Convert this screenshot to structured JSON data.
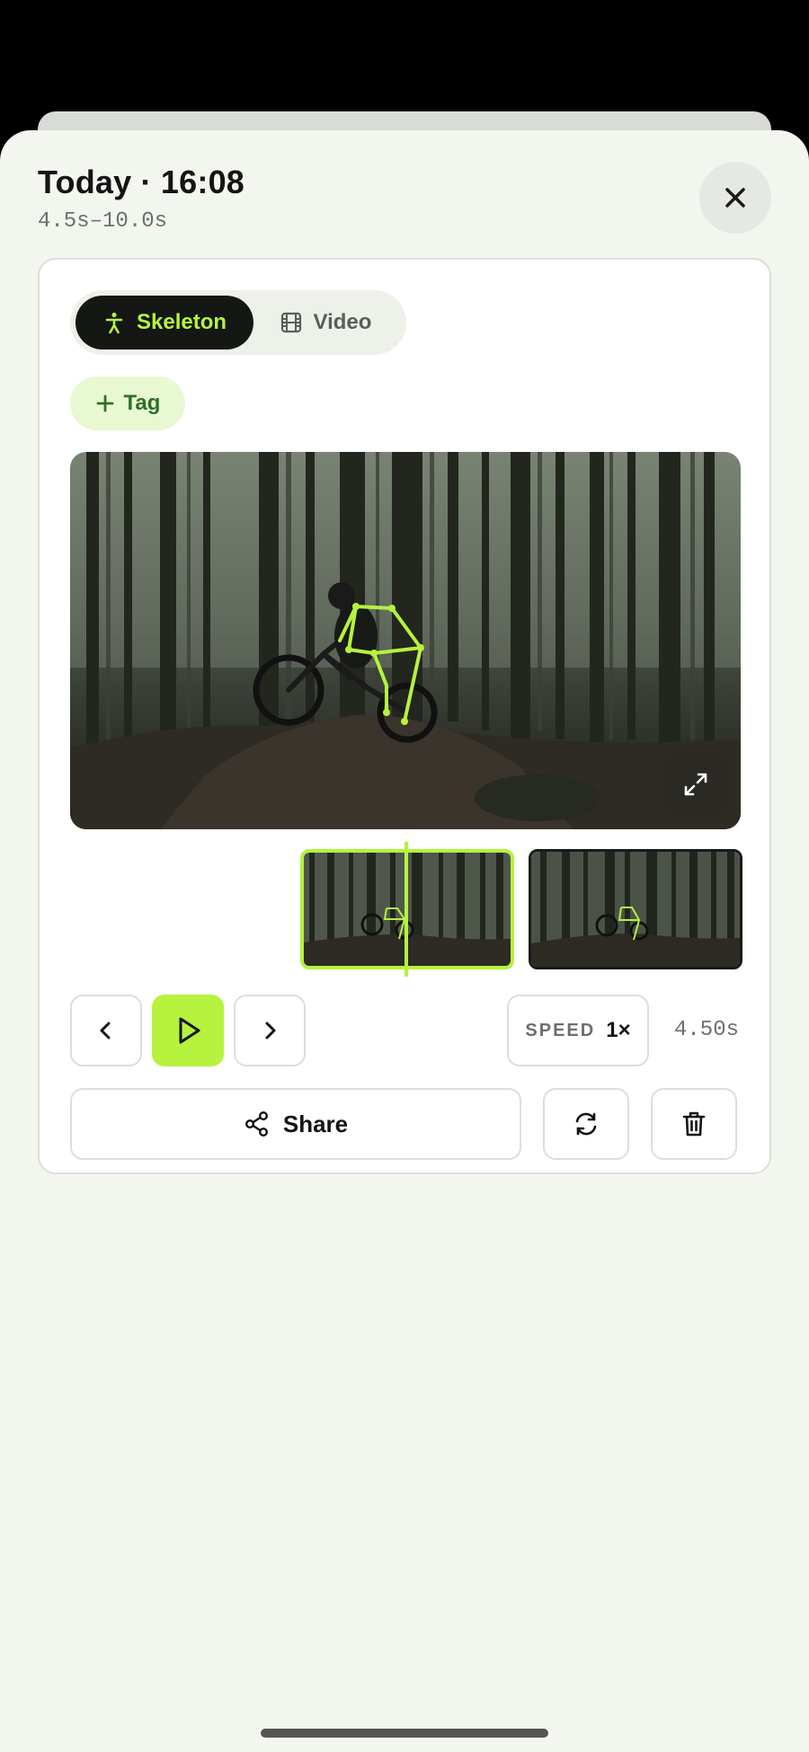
{
  "header": {
    "title": "Today · 16:08",
    "range": "4.5s–10.0s"
  },
  "view_toggle": {
    "options": [
      {
        "label": "Skeleton",
        "icon": "person-icon",
        "active": true
      },
      {
        "label": "Video",
        "icon": "film-icon",
        "active": false
      }
    ]
  },
  "tag_button": {
    "label": "Tag",
    "icon": "plus-icon"
  },
  "player": {
    "overlay": "skeleton",
    "accent_color": "#b6f23e",
    "expand_icon": "expand-icon"
  },
  "timeline": {
    "frames": [
      {
        "selected": true
      },
      {
        "selected": false
      }
    ]
  },
  "controls": {
    "prev_icon": "chevron-left-icon",
    "play_icon": "play-icon",
    "next_icon": "chevron-right-icon",
    "speed_label": "SPEED",
    "speed_value": "1×",
    "current_time": "4.50s"
  },
  "actions": {
    "share_label": "Share",
    "share_icon": "share-icon",
    "refresh_icon": "refresh-icon",
    "delete_icon": "trash-icon"
  }
}
